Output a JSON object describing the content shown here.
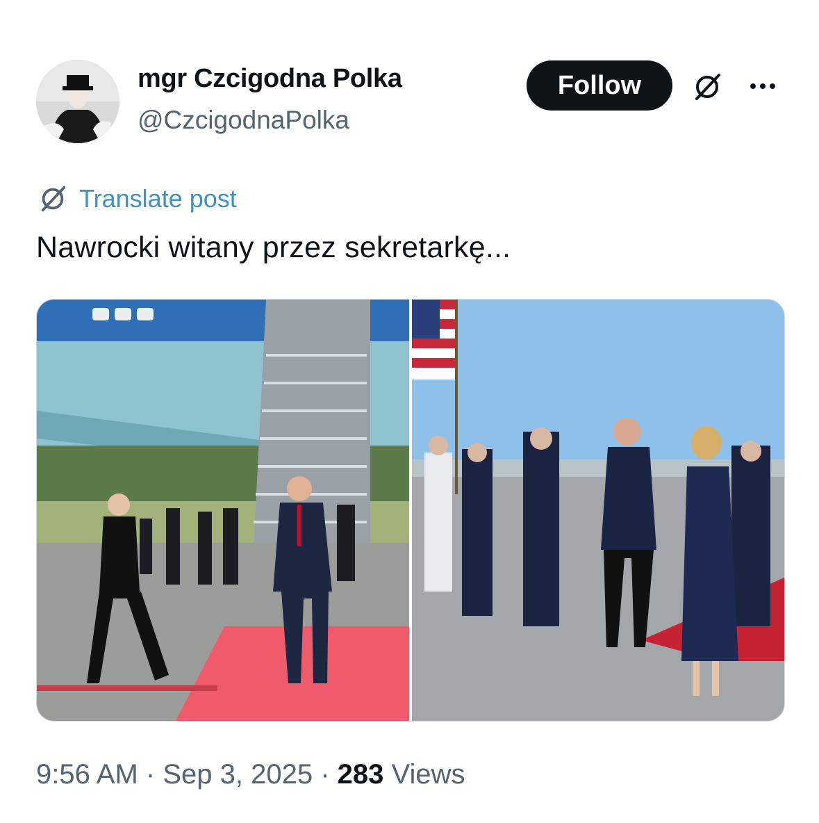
{
  "author": {
    "display_name": "mgr Czcigodna Polka",
    "handle": "@CzcigodnaPolka"
  },
  "actions": {
    "follow_label": "Follow",
    "grok_icon": "grok-icon",
    "more_icon": "more-icon"
  },
  "translate": {
    "label": "Translate post",
    "icon": "grok-icon"
  },
  "post": {
    "text": "Nawrocki witany przez sekretarkę..."
  },
  "meta": {
    "time": "9:56 AM",
    "separator": "·",
    "date": "Sep 3, 2025",
    "views_count": "283",
    "views_label": "Views"
  },
  "colors": {
    "accent": "#1d9bf0",
    "text_primary": "#0f1419",
    "text_secondary": "#536471",
    "button_bg": "#0f1419"
  }
}
